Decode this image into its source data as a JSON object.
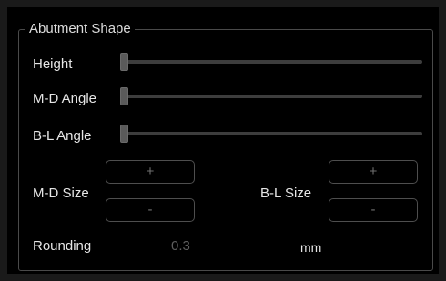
{
  "group": {
    "title": "Abutment Shape"
  },
  "sliders": [
    {
      "label": "Height",
      "value": 0
    },
    {
      "label": "M-D Angle",
      "value": 0
    },
    {
      "label": "B-L Angle",
      "value": 0
    }
  ],
  "md_size": {
    "label": "M-D Size",
    "plus_label": "+",
    "minus_label": "-"
  },
  "bl_size": {
    "label": "B-L Size",
    "plus_label": "+",
    "minus_label": "-"
  },
  "rounding": {
    "label": "Rounding",
    "value": "0.3",
    "unit": "mm"
  },
  "colors": {
    "background": "#000000",
    "border": "#4a4a4a",
    "text": "#e6e6e6",
    "disabled_text": "#5e5e5e"
  }
}
